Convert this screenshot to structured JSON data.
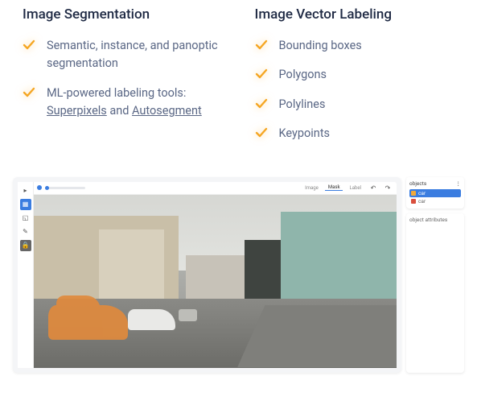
{
  "columns": [
    {
      "heading": "Image Segmentation",
      "items": [
        {
          "text": "Semantic, instance, and panoptic segmentation",
          "links": []
        },
        {
          "text": "ML-powered labeling tools: Superpixels and Autosegment",
          "links": [
            "Superpixels",
            "Autosegment"
          ]
        }
      ]
    },
    {
      "heading": "Image Vector Labeling",
      "items": [
        {
          "text": "Bounding boxes",
          "links": []
        },
        {
          "text": "Polygons",
          "links": []
        },
        {
          "text": "Polylines",
          "links": []
        },
        {
          "text": "Keypoints",
          "links": []
        }
      ]
    }
  ],
  "editor": {
    "top_tabs": [
      "Image",
      "Mask",
      "Label"
    ],
    "active_tab": "Mask",
    "tools": [
      "cursor",
      "grid",
      "crop",
      "pen",
      "lock"
    ],
    "objects_panel": {
      "title": "objects",
      "items": [
        {
          "label": "car",
          "color": "#f2a93b",
          "active": true
        },
        {
          "label": "car",
          "color": "#d94f3d",
          "active": false
        }
      ]
    },
    "attributes_panel": {
      "title": "object attributes"
    }
  }
}
